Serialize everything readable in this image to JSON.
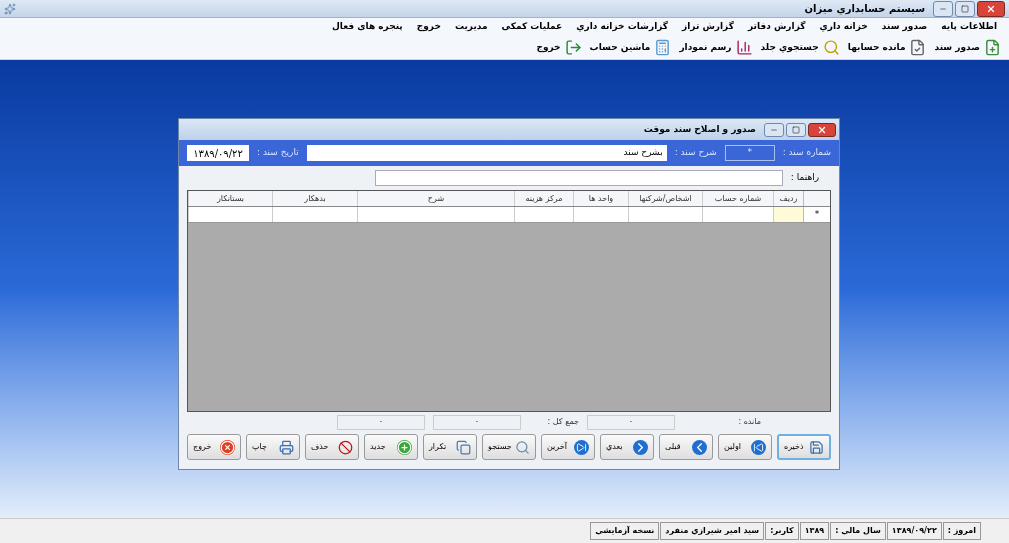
{
  "app_window": {
    "title": "سیستم حسابداري میزان"
  },
  "menu": [
    "اطلاعات پایه",
    "صدور سند",
    "خزانه داري",
    "گزارش دفاتر",
    "گزارش تراز",
    "گزارشات خزانه داري",
    "عملیات کمکی",
    "مدیریت",
    "خروج",
    "پنجره های فعال"
  ],
  "toolbar": [
    {
      "kind": "new-doc",
      "label": "صدور سند"
    },
    {
      "kind": "balance",
      "label": "مانده حسابها"
    },
    {
      "kind": "search",
      "label": "جستجوي جلد"
    },
    {
      "kind": "chart",
      "label": "رسم نمودار"
    },
    {
      "kind": "calculator",
      "label": "ماشین حساب"
    },
    {
      "kind": "exit",
      "label": "خروج"
    }
  ],
  "doc_window": {
    "title": "صدور و اصلاح سند موقت",
    "doc_number_label": "شماره سند :",
    "doc_number": "*",
    "description_label": "شرح سند :",
    "description": "بشرح سند",
    "date_label": "تاریخ سند :",
    "date": "۱۳۸۹/۰۹/۲۲",
    "hint_label": "راهنما :",
    "columns": [
      "ردیف",
      "شماره حساب",
      "اشخاص/شرکتها",
      "واحد ها",
      "مرکز هزینه",
      "شرح",
      "بدهکار",
      "بستانکار"
    ],
    "new_row_marker": "*",
    "balance_label": "مانده :",
    "balance": "۰",
    "total_label": "جمع کل :",
    "total_debit": "۰",
    "total_credit": "۰",
    "buttons": [
      {
        "kind": "save",
        "label": "ذخیره",
        "focused": true
      },
      {
        "kind": "first",
        "label": "اولین",
        "focused": false
      },
      {
        "kind": "prev",
        "label": "قبلی",
        "focused": false
      },
      {
        "kind": "next",
        "label": "بعدي",
        "focused": false
      },
      {
        "kind": "last",
        "label": "آخرین",
        "focused": false
      },
      {
        "kind": "search",
        "label": "جستجو",
        "focused": false
      },
      {
        "kind": "repeat",
        "label": "تکرار",
        "focused": false
      },
      {
        "kind": "new",
        "label": "جدید",
        "focused": false
      },
      {
        "kind": "delete",
        "label": "حذف",
        "focused": false
      },
      {
        "kind": "print",
        "label": "چاپ",
        "focused": false
      },
      {
        "kind": "exit",
        "label": "خروج",
        "focused": false
      }
    ]
  },
  "status_bar": [
    "امروز :",
    "۱۳۸۹/۰۹/۲۲",
    "سال مالي :",
    "۱۳۸۹",
    "کاربر:",
    "سید امیر شیرازي منفرد",
    "نسخه آزمایشي"
  ]
}
